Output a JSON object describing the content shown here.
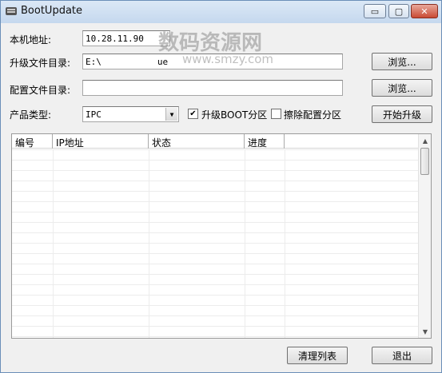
{
  "window": {
    "title": "BootUpdate",
    "caption_buttons": {
      "minimize": "▭",
      "maximize": "▢",
      "close": "✕"
    }
  },
  "form": {
    "ip_label": "本机地址:",
    "ip_value": "10.28.11.90",
    "upgrade_dir_label": "升级文件目录:",
    "upgrade_dir_value": "E:\\",
    "upgrade_dir_value_tail": "ue",
    "browse_label": "浏览...",
    "config_dir_label": "配置文件目录:",
    "config_dir_value": "",
    "browse2_label": "浏览...",
    "product_type_label": "产品类型:",
    "product_type_value": "IPC",
    "upgrade_boot_label": "升级BOOT分区",
    "upgrade_boot_checked": true,
    "erase_config_label": "擦除配置分区",
    "erase_config_checked": false,
    "start_upgrade_label": "开始升级"
  },
  "table": {
    "columns": [
      "编号",
      "IP地址",
      "状态",
      "进度"
    ],
    "rows": []
  },
  "footer": {
    "clear_list_label": "清理列表",
    "exit_label": "退出"
  },
  "watermark": {
    "title": "数码资源网",
    "url": "www.smzy.com"
  },
  "colors": {
    "titlebar": "#c5d8ee",
    "close_button": "#c94a33",
    "window_bg": "#f0f0f0"
  }
}
